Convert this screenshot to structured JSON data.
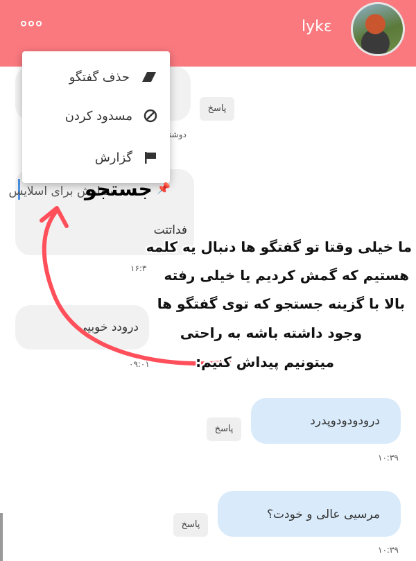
{
  "header": {
    "app_title": "lykɛ",
    "more_icon": "more-horizontal-icon",
    "background_color": "#f9797f"
  },
  "context_menu": {
    "items": [
      {
        "label": "حذف گفتگو",
        "icon": "eraser-icon"
      },
      {
        "label": "مسدود کردن",
        "icon": "block-icon"
      },
      {
        "label": "گزارش",
        "icon": "flag-icon"
      }
    ]
  },
  "messages": {
    "reply_label": "پاسخ",
    "day_label": "دوشنبه",
    "pinned_text": "سفارش برای اسلایس",
    "partial_text": "فداتتت",
    "partial_time": "۱۶:۳",
    "incoming_text": "درودد خوبیی",
    "incoming_time": "۰۹:۰۱",
    "out1_text": "درودودودوپدرد",
    "out1_time": "۱۰:۳۹",
    "out2_text": "مرسیی عالی و خودت؟",
    "out2_time": "۱۰:۳۹"
  },
  "annotation": {
    "title": "جستجو",
    "lines": [
      "ما خیلی وقتا تو گفتگو ها دنبال یه کلمه",
      "هستیم که گمش کردیم یا خیلی رفته",
      "بالا با گزینه جستجو که توی گفتگو ها",
      "وجود داشته باشه به راحتی",
      "میتونیم پیداش کنیم:"
    ],
    "arrow_color": "#ff4f5b"
  }
}
